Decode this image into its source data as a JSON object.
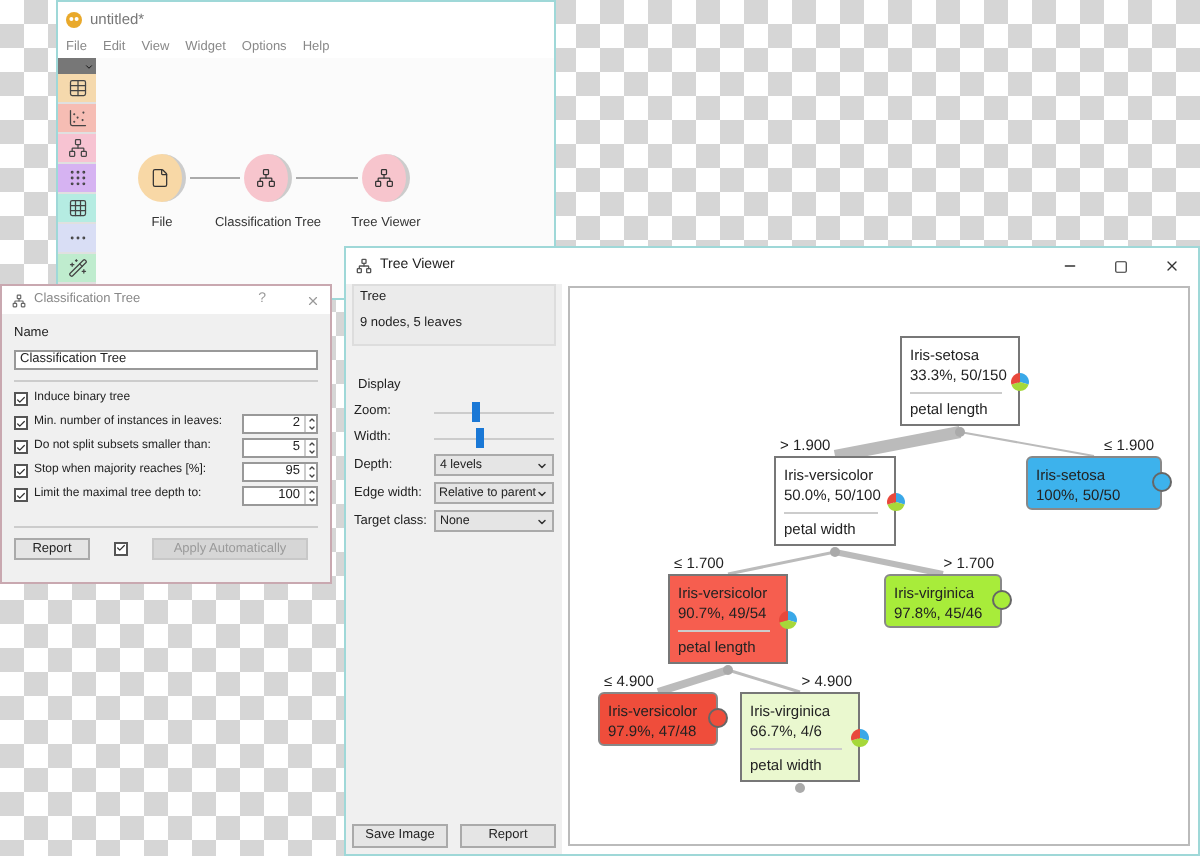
{
  "main_window": {
    "title": "untitled*",
    "menu": [
      "File",
      "Edit",
      "View",
      "Widget",
      "Options",
      "Help"
    ],
    "toolbox": [
      {
        "kind": "table",
        "color": "#f5d9ad"
      },
      {
        "kind": "scatter",
        "color": "#f6bdb4"
      },
      {
        "kind": "tree",
        "color": "#f7c3d2"
      },
      {
        "kind": "cluster",
        "color": "#d6b3f2"
      },
      {
        "kind": "grid",
        "color": "#b5ece2"
      },
      {
        "kind": "dots",
        "color": "#d9def5"
      },
      {
        "kind": "wand",
        "color": "#bfecce"
      }
    ],
    "workflow": [
      {
        "label": "File",
        "kind": "file",
        "color": "#f8d8a6"
      },
      {
        "label": "Classification Tree",
        "kind": "tree",
        "color": "#f7c5cd"
      },
      {
        "label": "Tree Viewer",
        "kind": "viewer",
        "color": "#f7c5cd"
      }
    ]
  },
  "dialog": {
    "title": "Classification Tree",
    "help": "?",
    "name_label": "Name",
    "name_value": "Classification Tree",
    "options": [
      {
        "kind": "check",
        "label": "Induce binary tree",
        "checked": true
      },
      {
        "kind": "spin",
        "label": "Min. number of instances in leaves:",
        "checked": true,
        "value": "2"
      },
      {
        "kind": "spin",
        "label": "Do not split subsets smaller than:",
        "checked": true,
        "value": "5"
      },
      {
        "kind": "spin",
        "label": "Stop when majority reaches [%]:",
        "checked": true,
        "value": "95"
      },
      {
        "kind": "spin",
        "label": "Limit the maximal tree depth to:",
        "checked": true,
        "value": "100"
      }
    ],
    "report": "Report",
    "auto_apply": {
      "checked": true
    },
    "apply": {
      "label": "Apply Automatically",
      "disabled": true
    }
  },
  "tree_viewer": {
    "title": "Tree Viewer",
    "info": {
      "title": "Tree",
      "text": "9 nodes, 5 leaves"
    },
    "display": {
      "title": "Display",
      "sliders": [
        {
          "label": "Zoom:",
          "level": 0.35
        },
        {
          "label": "Width:",
          "level": 0.38
        }
      ],
      "selects": [
        {
          "label": "Depth:",
          "value": "4 levels"
        },
        {
          "label": "Edge width:",
          "value": "Relative to parent"
        },
        {
          "label": "Target class:",
          "value": "None"
        }
      ]
    },
    "buttons": [
      "Save Image",
      "Report"
    ],
    "tree": {
      "kind": "split",
      "class": "Iris-setosa",
      "stats": "33.3%, 50/150",
      "split": "petal length",
      "color": "#ffffff",
      "children": [
        {
          "edge": "> 1.900",
          "kind": "split",
          "class": "Iris-versicolor",
          "stats": "50.0%, 50/100",
          "split": "petal width",
          "color": "#ffffff",
          "children": [
            {
              "edge": "≤ 1.700",
              "kind": "split",
              "class": "Iris-versicolor",
              "stats": "90.7%, 49/54",
              "split": "petal length",
              "color": "#f65e4f",
              "children": [
                {
                  "edge": "≤ 4.900",
                  "kind": "leaf",
                  "class": "Iris-versicolor",
                  "stats": "97.9%, 47/48",
                  "color": "#ef4d3b"
                },
                {
                  "edge": "> 4.900",
                  "kind": "split",
                  "class": "Iris-virginica",
                  "stats": "66.7%, 4/6",
                  "split": "petal width",
                  "color": "#eaf8cf"
                }
              ]
            },
            {
              "edge": "> 1.700",
              "kind": "leaf",
              "class": "Iris-virginica",
              "stats": "97.8%, 45/46",
              "color": "#a8ec3a"
            }
          ]
        },
        {
          "edge": "≤ 1.900",
          "kind": "leaf",
          "class": "Iris-setosa",
          "stats": "100%, 50/50",
          "color": "#3db2ec"
        }
      ]
    }
  }
}
